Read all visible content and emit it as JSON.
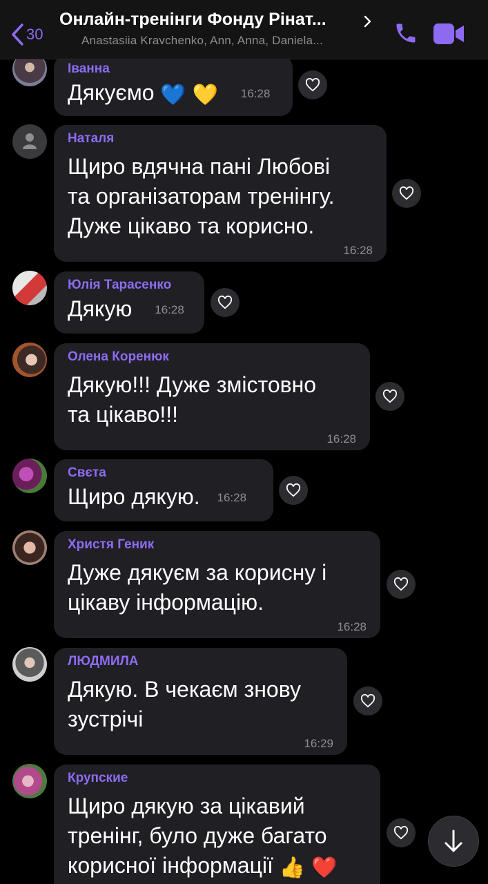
{
  "header": {
    "back_count": "30",
    "title": "Онлайн-тренінги Фонду Рінат...",
    "subtitle": "Anastasiia Kravchenko, Ann, Anna, Daniela..."
  },
  "colors": {
    "accent": "#8e6cf2",
    "bubble": "#1f1f24",
    "background": "#000000"
  },
  "messages": [
    {
      "sender": "Іванна",
      "text": "Дякуємо",
      "emoji": [
        "💙",
        "💛"
      ],
      "time": "16:28"
    },
    {
      "sender": "Наталя",
      "lines": [
        "Щиро вдячна пані Любові",
        "та організаторам тренінгу.",
        "Дуже цікаво та корисно."
      ],
      "time": "16:28"
    },
    {
      "sender": "Юлія Тарасенко",
      "text": "Дякую",
      "time": "16:28"
    },
    {
      "sender": "Олена Коренюк",
      "lines": [
        "Дякую!!! Дуже змістовно",
        "та цікаво!!!"
      ],
      "time": "16:28"
    },
    {
      "sender": "Свєта",
      "text": "Щиро дякую.",
      "time": "16:28"
    },
    {
      "sender": "Христя Геник",
      "lines": [
        "Дуже дякуєм за корисну і",
        "цікаву інформацію."
      ],
      "time": "16:28"
    },
    {
      "sender": "ЛЮДМИЛА",
      "lines": [
        "Дякую. В чекаєм знову",
        "зустрічі"
      ],
      "time": "16:29"
    },
    {
      "sender": "Крупские",
      "lines": [
        "Щиро дякую за цікавий",
        "тренінг, було дуже багато",
        "корисної інформації"
      ],
      "emoji": [
        "👍",
        "❤️"
      ]
    }
  ],
  "icons": {
    "back": "chevron-left-icon",
    "call": "phone-icon",
    "video": "video-camera-icon",
    "like": "heart-icon",
    "scroll": "arrow-down-icon"
  }
}
